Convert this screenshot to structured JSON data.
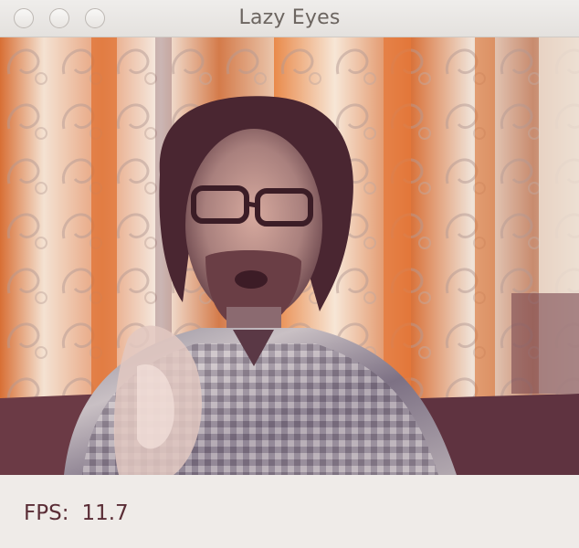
{
  "window": {
    "title": "Lazy Eyes"
  },
  "video": {
    "description_icon": "camera-feed"
  },
  "status": {
    "fps_label": "FPS:",
    "fps_value": "11.7"
  },
  "colors": {
    "window_bg": "#efebe8",
    "status_text": "#5a2d36",
    "curtain_orange": "#e07a3a"
  }
}
